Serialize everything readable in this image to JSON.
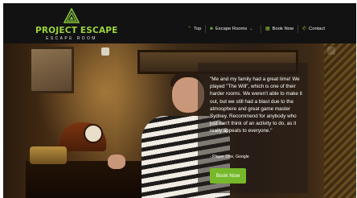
{
  "brand": {
    "name": "PROJECT ESCAPE",
    "tagline": "ESCAPE ROOM",
    "logo_icon": "triangle-maze-logo",
    "accent_color": "#86c23a"
  },
  "nav": {
    "items": [
      {
        "label": "Top",
        "icon": "chevron-up-icon"
      },
      {
        "label": "Escape Rooms",
        "icon": "puzzle-icon",
        "has_dropdown": true
      },
      {
        "label": "Book Now",
        "icon": "calendar-icon"
      },
      {
        "label": "Contact",
        "icon": "phone-icon"
      }
    ]
  },
  "hero": {
    "quote": "\"Me and my family had a great time! We played \"The Will\", which is one of their harder rooms. We weren't able to make it out, but we still had a blast due to the atmosphere and great game master Sydney. Recommend for anybody who just can't think of an activity to do, as it really appeals to everyone.\"",
    "author": "- Player One, Google",
    "cta_label": "Book Now",
    "cta_color": "#76b82a"
  }
}
